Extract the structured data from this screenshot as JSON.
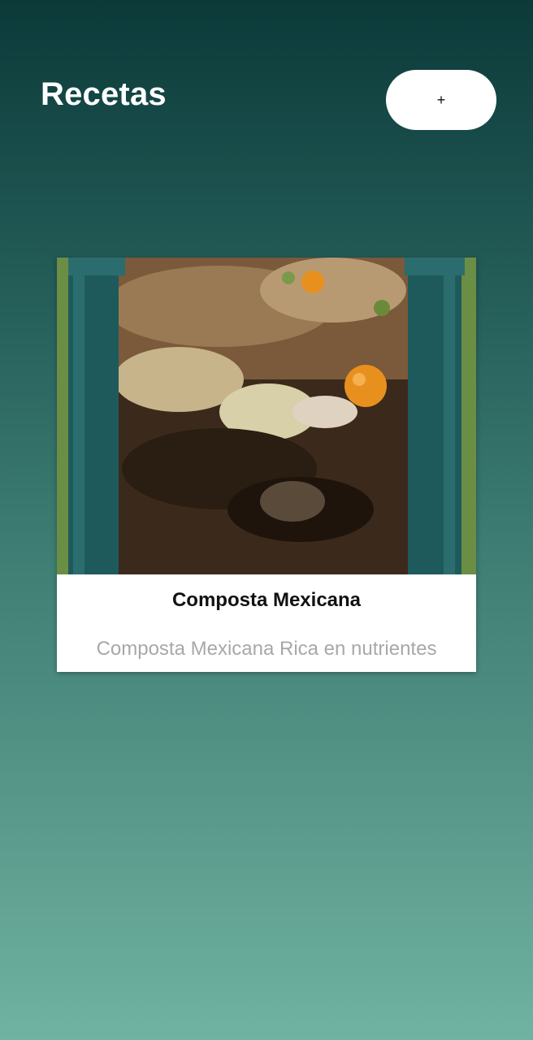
{
  "header": {
    "title": "Recetas",
    "add_button_label": "+"
  },
  "recipes": [
    {
      "title": "Composta Mexicana",
      "description": "Composta Mexicana Rica en nutrientes",
      "image_icon": "compost-bin-photo"
    }
  ],
  "colors": {
    "gradient_top": "#0b3a39",
    "gradient_bottom": "#70b3a2",
    "card_background": "#ffffff",
    "description_text": "#a8a8a8"
  }
}
